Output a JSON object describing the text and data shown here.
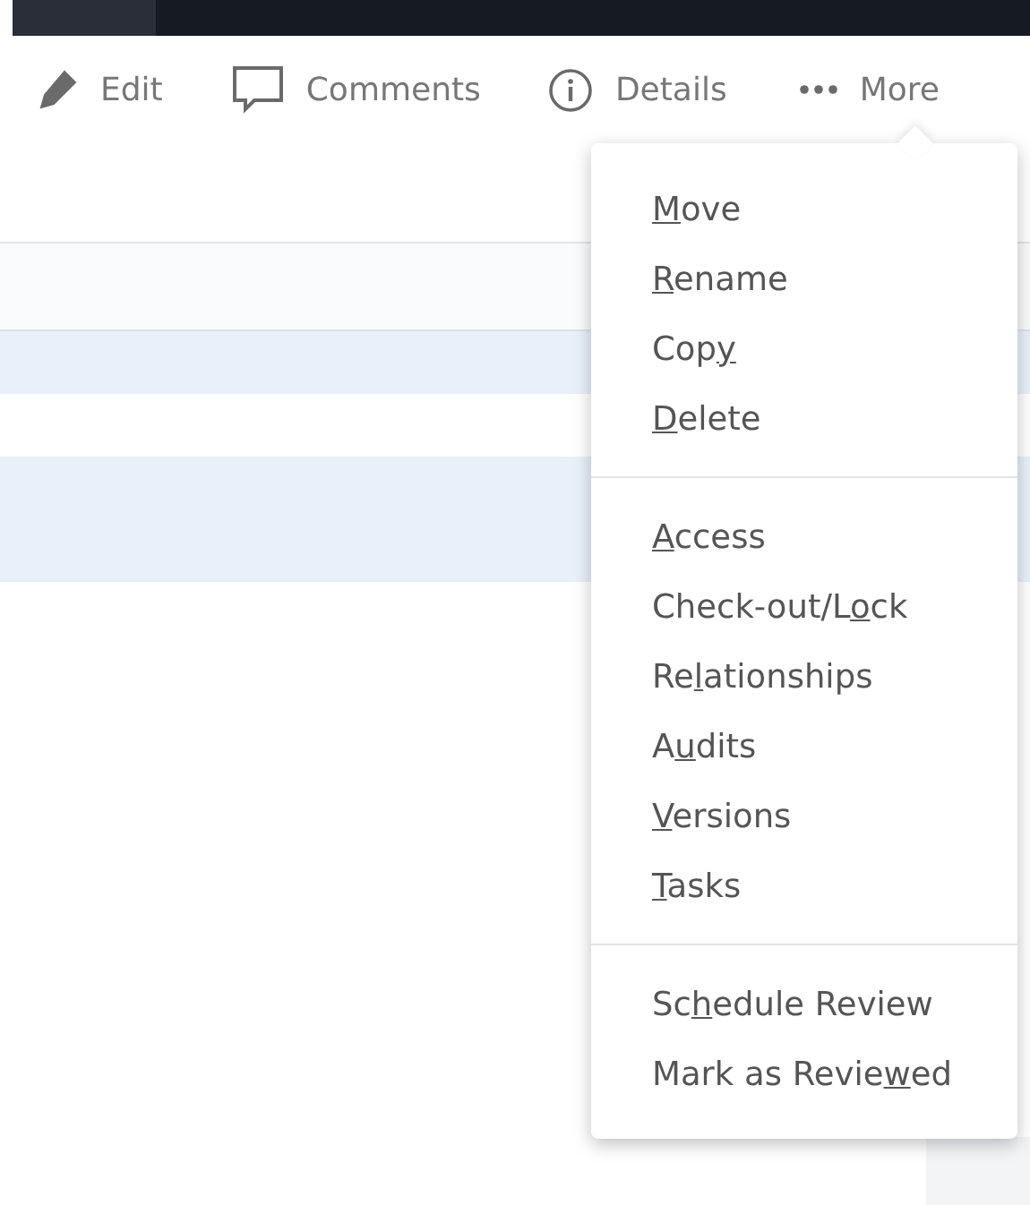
{
  "toolbar": [
    {
      "kind": "edit",
      "label": "Edit"
    },
    {
      "kind": "comments",
      "label": "Comments"
    },
    {
      "kind": "details",
      "label": "Details"
    },
    {
      "kind": "more",
      "label": "More"
    }
  ],
  "table": {
    "rows": [
      {
        "kind": "single",
        "selected": true
      },
      {
        "kind": "single",
        "selected": false
      },
      {
        "kind": "double",
        "selected": true
      }
    ]
  },
  "menu": {
    "groups": [
      [
        {
          "key": "M",
          "after": "ove"
        },
        {
          "key": "R",
          "after": "ename"
        },
        {
          "before": "Cop",
          "key": "y"
        },
        {
          "key": "D",
          "after": "elete"
        }
      ],
      [
        {
          "key": "A",
          "after": "ccess"
        },
        {
          "before": "Check-out/L",
          "key": "o",
          "after": "ck"
        },
        {
          "before": "Re",
          "key": "l",
          "after": "ationships"
        },
        {
          "before": "A",
          "key": "u",
          "after": "dits"
        },
        {
          "key": "V",
          "after": "ersions"
        },
        {
          "key": "T",
          "after": "asks"
        }
      ],
      [
        {
          "before": "Sc",
          "key": "h",
          "after": "edule Review"
        },
        {
          "before": "Mark as Revie",
          "key": "w",
          "after": "ed"
        }
      ]
    ]
  }
}
